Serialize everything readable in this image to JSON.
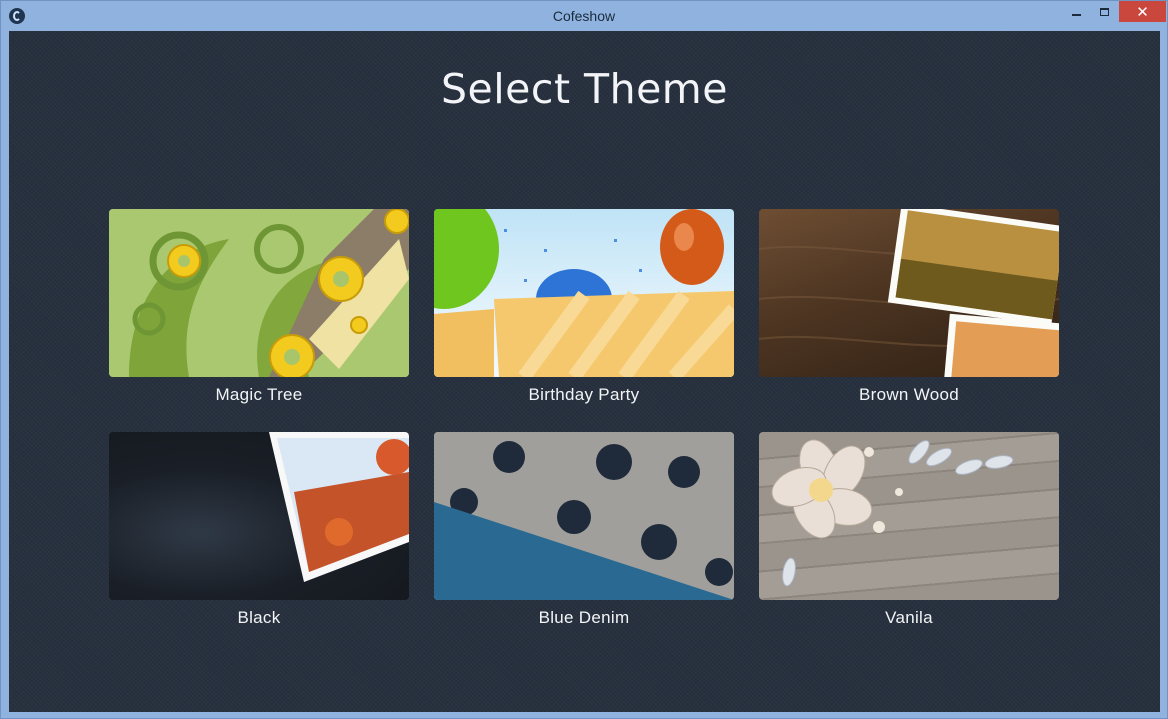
{
  "window": {
    "title": "Cofeshow",
    "controls": {
      "minimize": "minimize",
      "maximize": "maximize",
      "close": "✕"
    }
  },
  "page": {
    "heading": "Select Theme"
  },
  "themes": [
    {
      "label": "Magic Tree",
      "icon": "magic-tree-thumbnail"
    },
    {
      "label": "Birthday Party",
      "icon": "birthday-party-thumbnail"
    },
    {
      "label": "Brown Wood",
      "icon": "brown-wood-thumbnail"
    },
    {
      "label": "Black",
      "icon": "black-thumbnail"
    },
    {
      "label": "Blue Denim",
      "icon": "blue-denim-thumbnail"
    },
    {
      "label": "Vanila",
      "icon": "vanila-thumbnail"
    }
  ],
  "colors": {
    "background": "#27303e",
    "frame": "#8fb3de",
    "close": "#c9473d",
    "text": "#f3f4f6"
  }
}
